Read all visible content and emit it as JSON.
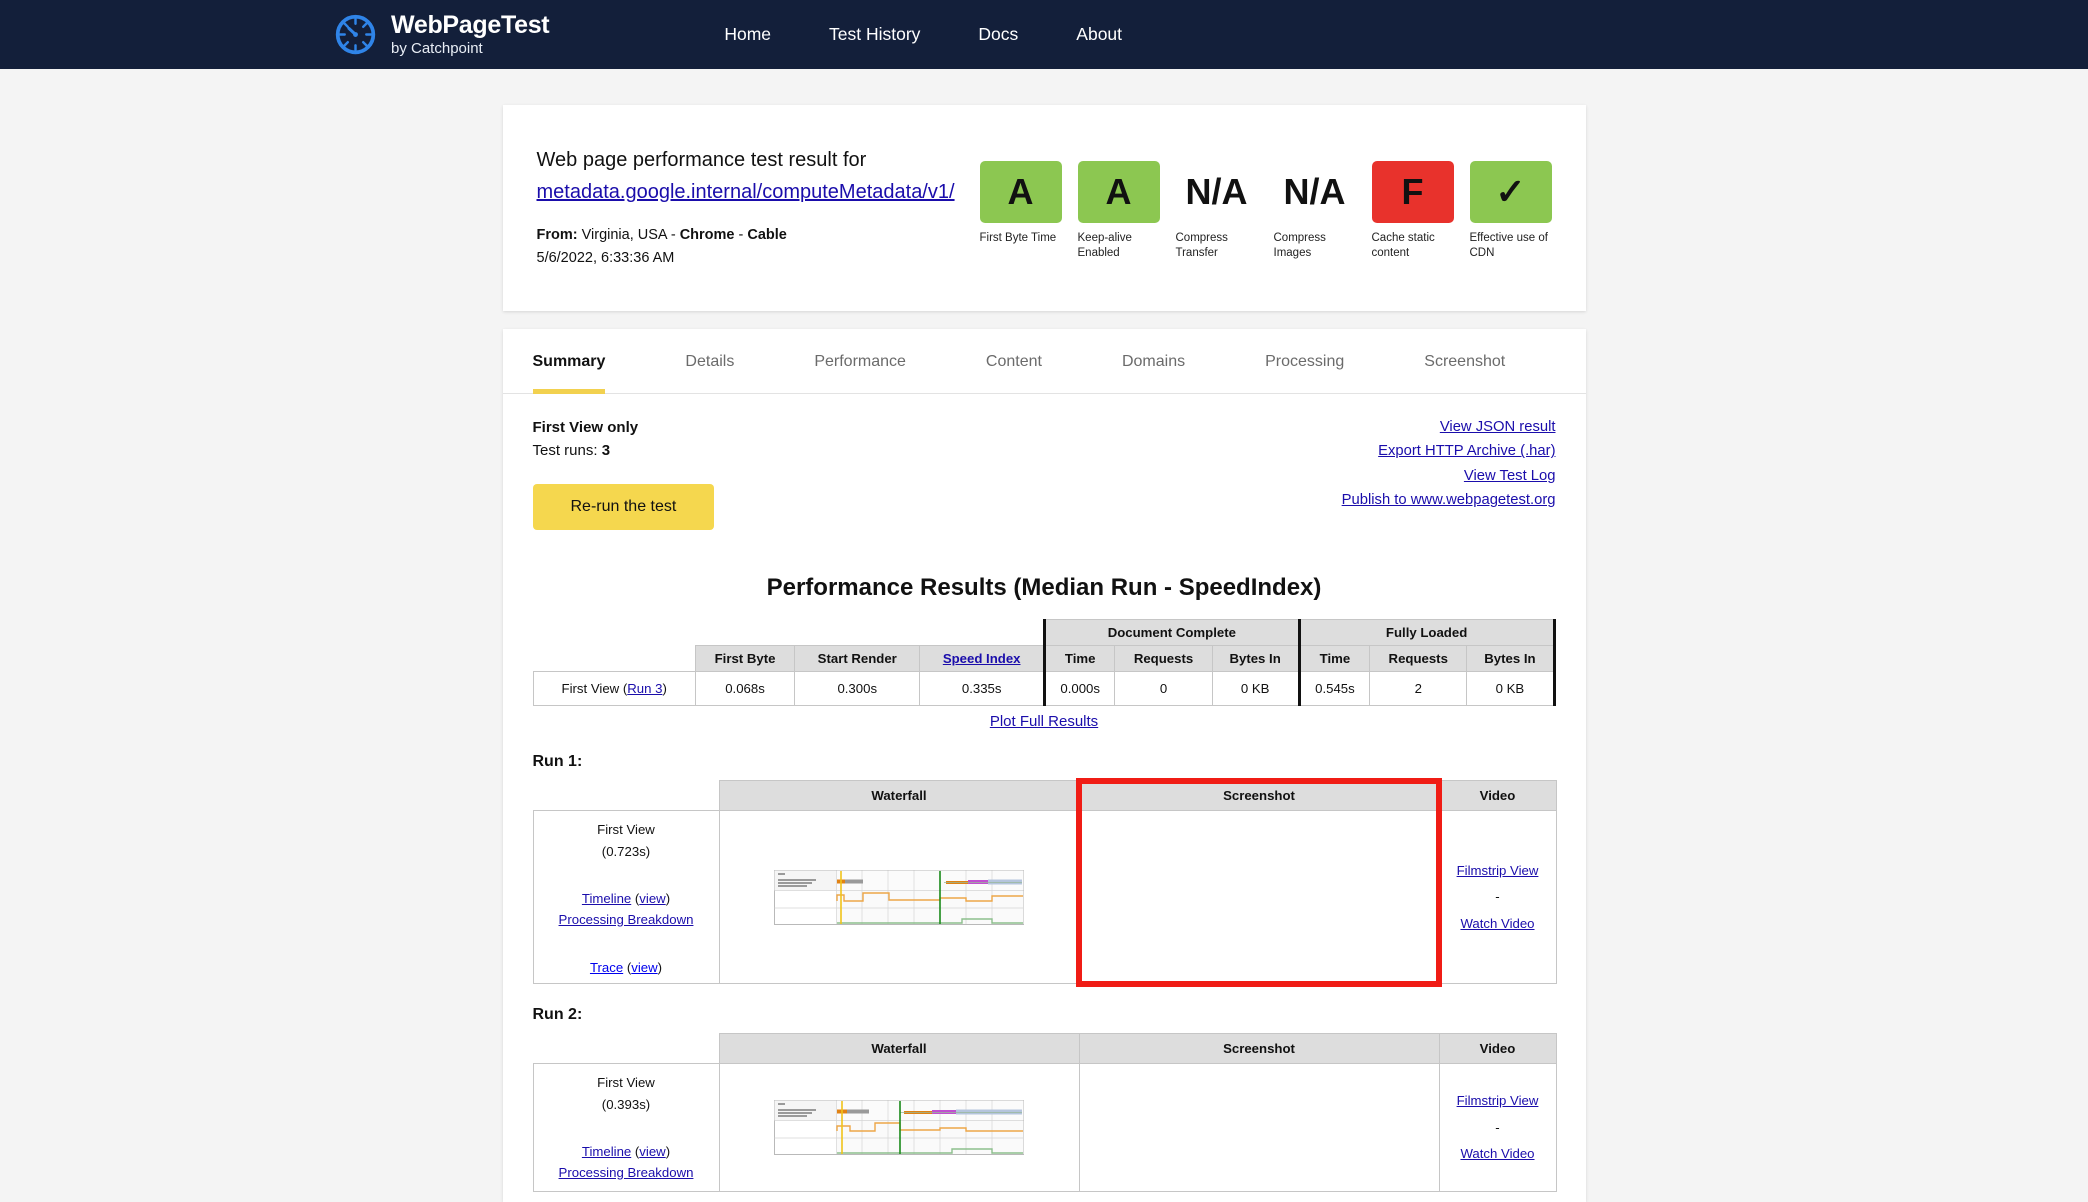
{
  "navbar": {
    "brand_title": "WebPageTest",
    "brand_subtitle": "by Catchpoint",
    "logo_icon": "speedometer-icon",
    "links": [
      {
        "label": "Home"
      },
      {
        "label": "Test History"
      },
      {
        "label": "Docs"
      },
      {
        "label": "About"
      }
    ],
    "bg_color": "#131f3a"
  },
  "result_header": {
    "heading": "Web page performance test result for",
    "url": "metadata.google.internal/computeMetadata/v1/",
    "from_label": "From:",
    "from_value": "Virginia, USA",
    "sep": " - ",
    "browser": "Chrome",
    "connection": "Cable",
    "timestamp": "5/6/2022, 6:33:36 AM",
    "grades": [
      {
        "value": "A",
        "label": "First Byte Time",
        "color": "#8cc751",
        "has_box": true
      },
      {
        "value": "A",
        "label": "Keep-alive Enabled",
        "color": "#8cc751",
        "has_box": true
      },
      {
        "value": "N/A",
        "label": "Compress Transfer",
        "color": "transparent",
        "has_box": false
      },
      {
        "value": "N/A",
        "label": "Compress Images",
        "color": "transparent",
        "has_box": false
      },
      {
        "value": "F",
        "label": "Cache static content",
        "color": "#e8322c",
        "has_box": true
      },
      {
        "value": "✓",
        "label": "Effective use of CDN",
        "color": "#8cc751",
        "has_box": true
      }
    ]
  },
  "tabs": [
    {
      "label": "Summary",
      "active": true
    },
    {
      "label": "Details",
      "active": false
    },
    {
      "label": "Performance",
      "active": false
    },
    {
      "label": "Content",
      "active": false
    },
    {
      "label": "Domains",
      "active": false
    },
    {
      "label": "Processing",
      "active": false
    },
    {
      "label": "Screenshot",
      "active": false
    }
  ],
  "summary": {
    "view_label": "First View only",
    "test_runs_label": "Test runs:",
    "test_runs_value": "3",
    "rerun_button": "Re-run the test",
    "links": [
      {
        "label": "View JSON result"
      },
      {
        "label": "Export HTTP Archive (.har)"
      },
      {
        "label": "View Test Log"
      },
      {
        "label": "Publish to www.webpagetest.org"
      }
    ]
  },
  "performance": {
    "title": "Performance Results (Median Run - SpeedIndex)",
    "group_headers": [
      {
        "label": "Document Complete",
        "span": 3
      },
      {
        "label": "Fully Loaded",
        "span": 3
      }
    ],
    "columns": [
      "First Byte",
      "Start Render",
      "Speed Index",
      "Time",
      "Requests",
      "Bytes In",
      "Time",
      "Requests",
      "Bytes In"
    ],
    "row_label_prefix": "First View (",
    "row_label_link": "Run 3",
    "row_label_suffix": ")",
    "values": [
      "0.068s",
      "0.300s",
      "0.335s",
      "0.000s",
      "0",
      "0 KB",
      "0.545s",
      "2",
      "0 KB"
    ],
    "plot_link": "Plot Full Results"
  },
  "runs": [
    {
      "title": "Run 1:",
      "headers": [
        "Waterfall",
        "Screenshot",
        "Video"
      ],
      "view_label": "First View",
      "load_time": "(0.723s)",
      "timeline_label": "Timeline",
      "timeline_view": "view",
      "processing_label": "Processing Breakdown",
      "trace_label": "Trace",
      "trace_view": "view",
      "filmstrip_label": "Filmstrip View",
      "video_sep": "-",
      "watch_label": "Watch Video",
      "highlighted": true,
      "highlight_color": "#f01c15"
    },
    {
      "title": "Run 2:",
      "headers": [
        "Waterfall",
        "Screenshot",
        "Video"
      ],
      "view_label": "First View",
      "load_time": "(0.393s)",
      "timeline_label": "Timeline",
      "timeline_view": "view",
      "processing_label": "Processing Breakdown",
      "trace_label": "",
      "trace_view": "",
      "filmstrip_label": "Filmstrip View",
      "video_sep": "-",
      "watch_label": "Watch Video",
      "highlighted": false,
      "highlight_color": ""
    }
  ]
}
